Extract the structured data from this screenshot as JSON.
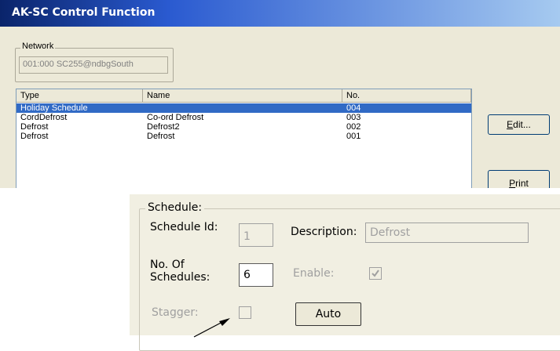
{
  "dialog": {
    "title": "AK-SC Control Function",
    "network": {
      "label": "Network",
      "value": "001:000   SC255@ndbgSouth"
    },
    "table": {
      "columns": [
        "Type",
        "Name",
        "No."
      ],
      "rows": [
        {
          "type": "Holiday Schedule",
          "name": "",
          "no": "004",
          "selected": true
        },
        {
          "type": "CordDefrost",
          "name": "Co-ord Defrost",
          "no": "003"
        },
        {
          "type": "Defrost",
          "name": "Defrost2",
          "no": "002"
        },
        {
          "type": "Defrost",
          "name": "Defrost",
          "no": "001"
        }
      ]
    },
    "buttons": {
      "edit_prefix": "E",
      "edit_rest": "dit...",
      "print_prefix": "P",
      "print_rest": "rint"
    }
  },
  "schedule": {
    "group_label": "Schedule:",
    "schedule_id_label": "Schedule Id:",
    "schedule_id_value": "1",
    "description_label": "Description:",
    "description_value": "Defrost",
    "no_of_schedules_label_1": "No. Of",
    "no_of_schedules_label_2": "Schedules:",
    "no_of_schedules_value": "6",
    "enable_label": "Enable:",
    "enable_checked": true,
    "stagger_label": "Stagger:",
    "stagger_checked": false,
    "auto_label": "Auto"
  },
  "colors": {
    "selection": "#316ac5",
    "title_bar": "#0a246a"
  }
}
